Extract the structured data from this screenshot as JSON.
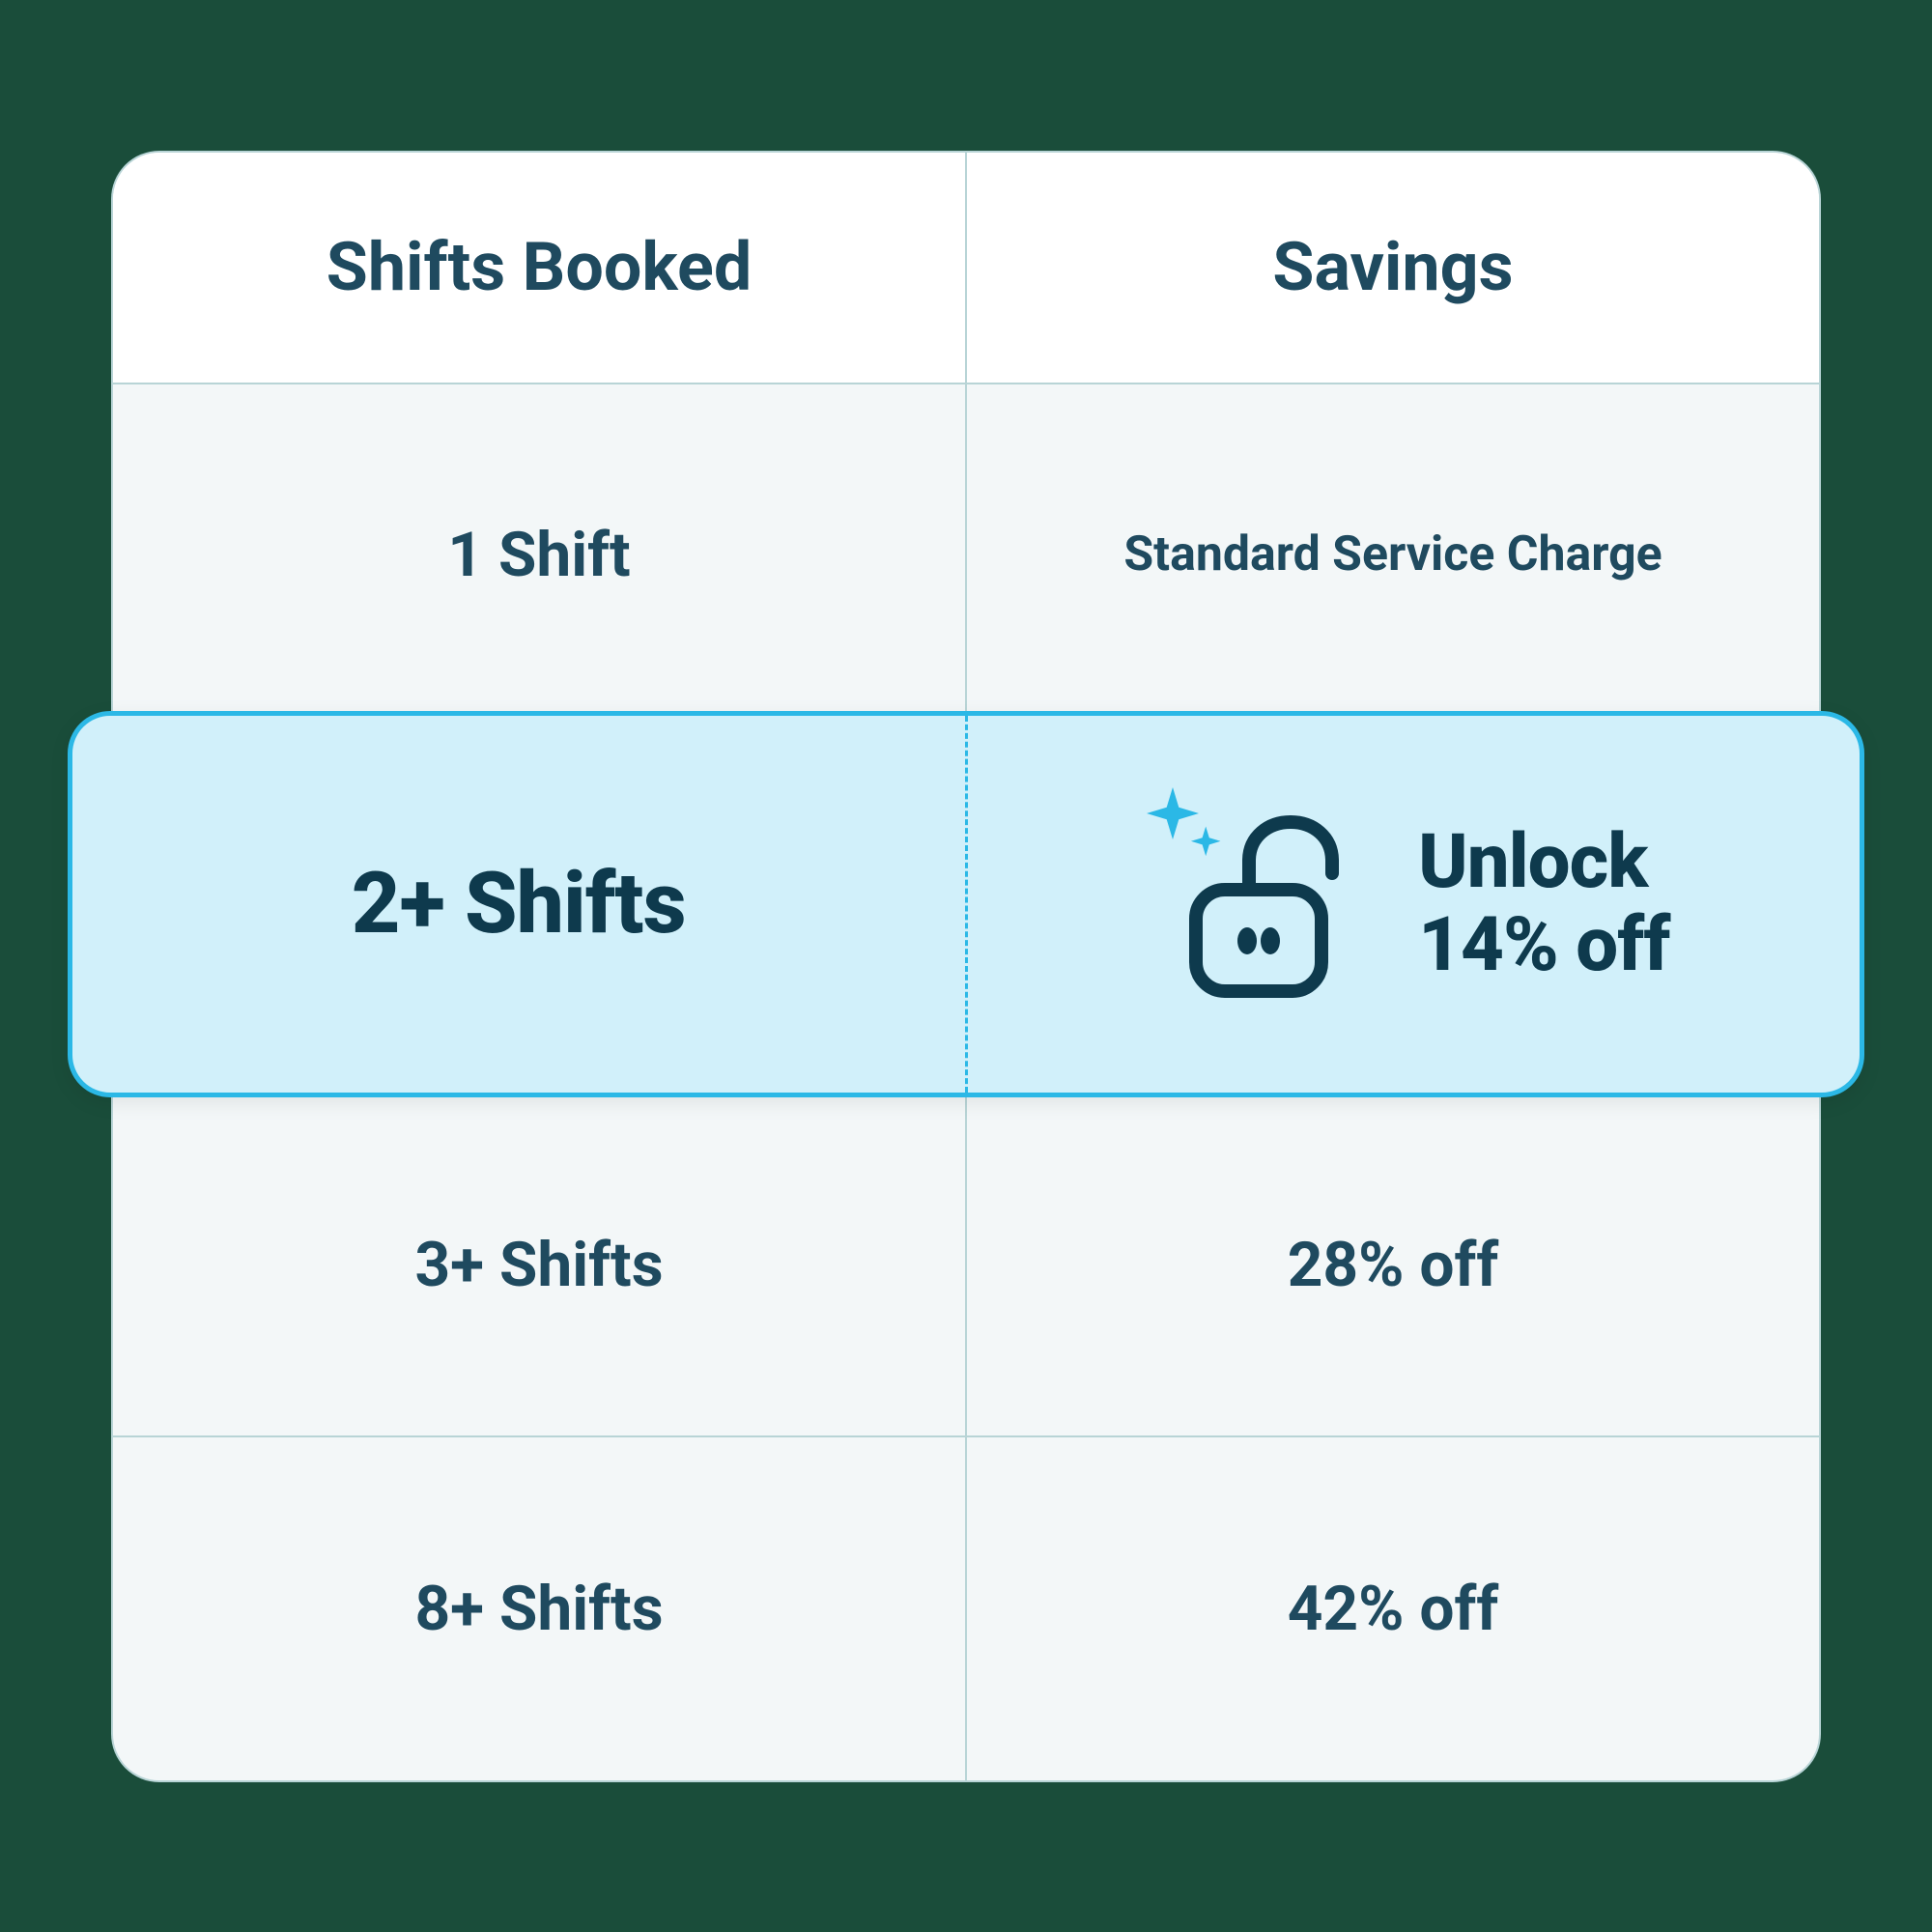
{
  "headers": {
    "left": "Shifts Booked",
    "right": "Savings"
  },
  "rows": [
    {
      "shifts": "1 Shift",
      "savings": "Standard Service Charge",
      "highlighted": false,
      "smallSavings": true
    },
    {
      "shifts": "2+ Shifts",
      "savings": "Unlock 14% off",
      "highlighted": true
    },
    {
      "shifts": "3+ Shifts",
      "savings": "28% off",
      "highlighted": false
    },
    {
      "shifts": "8+ Shifts",
      "savings": "42% off",
      "highlighted": false
    }
  ],
  "highlight": {
    "shifts": "2+ Shifts",
    "savingsLine1": "Unlock",
    "savingsLine2": "14% off"
  }
}
